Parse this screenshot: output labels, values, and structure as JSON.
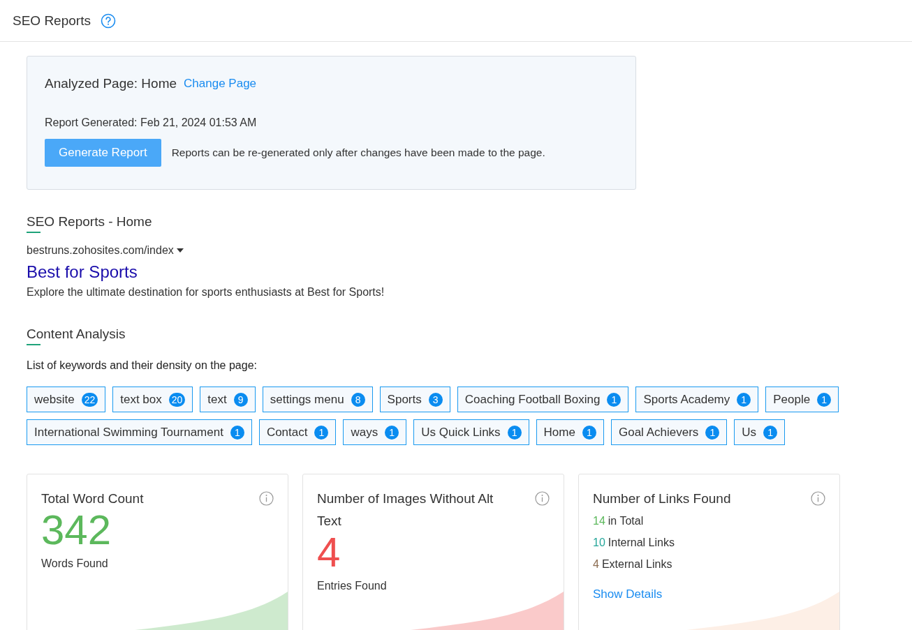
{
  "header": {
    "title": "SEO Reports"
  },
  "panel": {
    "analyzed_label": "Analyzed Page: Home",
    "change_link": "Change Page",
    "generated": "Report Generated: Feb 21, 2024 01:53 AM",
    "button": "Generate Report",
    "note": "Reports can be re-generated only after changes have been made to the page."
  },
  "preview": {
    "heading": "SEO Reports - Home",
    "url": "bestruns.zohosites.com/index",
    "title": "Best for Sports",
    "description": "Explore the ultimate destination for sports enthusiasts at Best for Sports!"
  },
  "content_analysis": {
    "heading": "Content Analysis",
    "intro": "List of keywords and their density on the page:",
    "keywords": [
      {
        "word": "website",
        "count": "22"
      },
      {
        "word": "text box",
        "count": "20"
      },
      {
        "word": "text",
        "count": "9"
      },
      {
        "word": "settings menu",
        "count": "8"
      },
      {
        "word": "Sports",
        "count": "3"
      },
      {
        "word": "Coaching Football Boxing",
        "count": "1"
      },
      {
        "word": "Sports Academy",
        "count": "1"
      },
      {
        "word": "People",
        "count": "1"
      },
      {
        "word": "International Swimming Tournament",
        "count": "1"
      },
      {
        "word": "Contact",
        "count": "1"
      },
      {
        "word": "ways",
        "count": "1"
      },
      {
        "word": "Us Quick Links",
        "count": "1"
      },
      {
        "word": "Home",
        "count": "1"
      },
      {
        "word": "Goal Achievers",
        "count": "1"
      },
      {
        "word": "Us",
        "count": "1"
      }
    ]
  },
  "cards": [
    {
      "kind": "count",
      "title": "Total Word Count",
      "value": "342",
      "caption": "Words Found",
      "color": "#5cb85c"
    },
    {
      "kind": "count",
      "title": "Number of Images Without Alt Text",
      "value": "4",
      "caption": "Entries Found",
      "color": "#ef4f4f"
    },
    {
      "kind": "links",
      "title": "Number of Links Found",
      "color": "#fdefe6",
      "links": [
        {
          "number": "14",
          "label": "in Total",
          "color": "#5cb85c"
        },
        {
          "number": "10",
          "label": "Internal Links",
          "color": "#26a69a"
        },
        {
          "number": "4",
          "label": "External Links",
          "color": "#8d6e53"
        }
      ],
      "link": "Show Details"
    }
  ]
}
